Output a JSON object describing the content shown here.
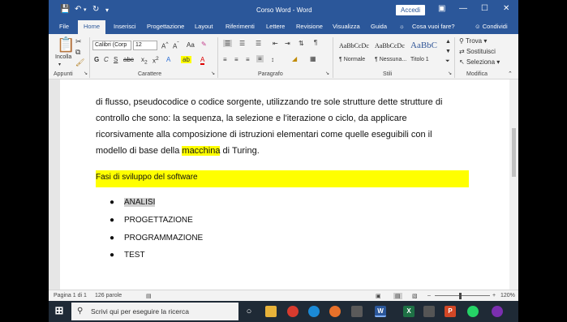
{
  "window": {
    "title": "Corso Word  -  Word",
    "signin_label": "Accedi"
  },
  "tabs": [
    {
      "label": "File"
    },
    {
      "label": "Home"
    },
    {
      "label": "Inserisci"
    },
    {
      "label": "Progettazione"
    },
    {
      "label": "Layout"
    },
    {
      "label": "Riferimenti"
    },
    {
      "label": "Lettere"
    },
    {
      "label": "Revisione"
    },
    {
      "label": "Visualizza"
    },
    {
      "label": "Guida"
    }
  ],
  "tell_me": "Cosa vuoi fare?",
  "share": "Condividi",
  "ribbon": {
    "paste_label": "Incolla",
    "font_name": "Calibri (Corp",
    "font_size": "12",
    "groups": {
      "clipboard": "Appunti",
      "font": "Carattere",
      "paragraph": "Paragrafo",
      "styles": "Stili",
      "editing": "Modifica"
    },
    "styles": [
      {
        "sample": "AaBbCcDc",
        "name": "¶ Normale"
      },
      {
        "sample": "AaBbCcDc",
        "name": "¶ Nessuna..."
      },
      {
        "sample": "AaBbC",
        "name": "Titolo 1"
      }
    ],
    "editing": {
      "find": "Trova",
      "replace": "Sostituisci",
      "select": "Seleziona"
    }
  },
  "document": {
    "lines": [
      "di flusso, pseudocodice o codice sorgente, utilizzando tre sole strutture dette strutture di",
      "controllo che sono: la sequenza, la selezione e l'iterazione o ciclo, da applicare",
      "ricorsivamente alla composizione di istruzioni elementari come quelle eseguibili con il"
    ],
    "last_line_pre": "modello di base della ",
    "last_line_hl": "macchina",
    "last_line_post": " di Turing.",
    "heading": "Fasi di sviluppo del software",
    "bullets": [
      "ANALISI",
      "PROGETTAZIONE",
      "PROGRAMMAZIONE",
      "TEST"
    ]
  },
  "status": {
    "page": "Pagina 1 di 1",
    "words": "126 parole",
    "zoom": "120%"
  },
  "taskbar": {
    "search_placeholder": "Scrivi qui per eseguire la ricerca"
  },
  "colors": {
    "word_blue": "#2b579a",
    "highlight": "#ffff00"
  }
}
